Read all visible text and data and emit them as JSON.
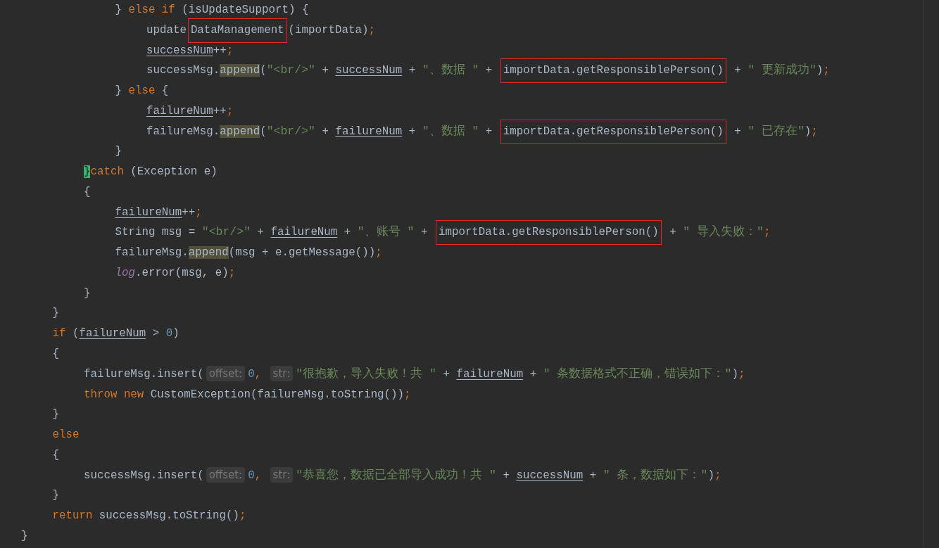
{
  "editor": {
    "lines": [
      {
        "children": [
          {
            "children": [
              {
                "children": [
                  {
                    "tokens": [
                      {
                        "kind": "plain",
                        "text": "} "
                      },
                      {
                        "kind": "keyword",
                        "text": "else if"
                      },
                      {
                        "kind": "plain",
                        "text": " (isUpdateSupport) {"
                      }
                    ]
                  },
                  {
                    "children": [
                      {
                        "tokens": [
                          {
                            "kind": "plain",
                            "text": "update"
                          },
                          {
                            "kind": "marked",
                            "text": "DataManagement"
                          },
                          {
                            "kind": "plain",
                            "text": "(importData)"
                          },
                          {
                            "kind": "keyword",
                            "text": ";"
                          }
                        ]
                      },
                      {
                        "tokens": [
                          {
                            "kind": "variable",
                            "text": "successNum"
                          },
                          {
                            "kind": "plain",
                            "text": "++"
                          },
                          {
                            "kind": "keyword",
                            "text": ";"
                          }
                        ]
                      },
                      {
                        "tokens": [
                          {
                            "kind": "plain",
                            "text": "successMsg."
                          },
                          {
                            "kind": "usage",
                            "text": "append"
                          },
                          {
                            "kind": "plain",
                            "text": "("
                          },
                          {
                            "kind": "string",
                            "text": "\"<br/>\""
                          },
                          {
                            "kind": "plain",
                            "text": " + "
                          },
                          {
                            "kind": "variable",
                            "text": "successNum"
                          },
                          {
                            "kind": "plain",
                            "text": " + "
                          },
                          {
                            "kind": "string",
                            "text": "\"、数据 \""
                          },
                          {
                            "kind": "plain",
                            "text": " + "
                          },
                          {
                            "kind": "marked",
                            "text": "importData.getResponsiblePerson()"
                          },
                          {
                            "kind": "plain",
                            "text": " + "
                          },
                          {
                            "kind": "string",
                            "text": "\" 更新成功\""
                          },
                          {
                            "kind": "plain",
                            "text": ")"
                          },
                          {
                            "kind": "keyword",
                            "text": ";"
                          }
                        ]
                      }
                    ]
                  },
                  {
                    "tokens": [
                      {
                        "kind": "plain",
                        "text": "} "
                      },
                      {
                        "kind": "keyword",
                        "text": "else"
                      },
                      {
                        "kind": "plain",
                        "text": " {"
                      }
                    ]
                  },
                  {
                    "children": [
                      {
                        "tokens": [
                          {
                            "kind": "variable",
                            "text": "failureNum"
                          },
                          {
                            "kind": "plain",
                            "text": "++"
                          },
                          {
                            "kind": "keyword",
                            "text": ";"
                          }
                        ]
                      },
                      {
                        "tokens": [
                          {
                            "kind": "plain",
                            "text": "failureMsg."
                          },
                          {
                            "kind": "usage",
                            "text": "append"
                          },
                          {
                            "kind": "plain",
                            "text": "("
                          },
                          {
                            "kind": "string",
                            "text": "\"<br/>\""
                          },
                          {
                            "kind": "plain",
                            "text": " + "
                          },
                          {
                            "kind": "variable",
                            "text": "failureNum"
                          },
                          {
                            "kind": "plain",
                            "text": " + "
                          },
                          {
                            "kind": "string",
                            "text": "\"、数据 \""
                          },
                          {
                            "kind": "plain",
                            "text": " + "
                          },
                          {
                            "kind": "marked",
                            "text": "importData.getResponsiblePerson()"
                          },
                          {
                            "kind": "plain",
                            "text": " + "
                          },
                          {
                            "kind": "string",
                            "text": "\" 已存在\""
                          },
                          {
                            "kind": "plain",
                            "text": ")"
                          },
                          {
                            "kind": "keyword",
                            "text": ";"
                          }
                        ]
                      }
                    ]
                  },
                  {
                    "tokens": [
                      {
                        "kind": "plain",
                        "text": "}"
                      }
                    ]
                  }
                ]
              },
              {
                "tokens": [
                  {
                    "kind": "brace",
                    "text": "}"
                  },
                  {
                    "kind": "keyword",
                    "text": "catch"
                  },
                  {
                    "kind": "plain",
                    "text": " (Exception e)"
                  }
                ]
              },
              {
                "tokens": [
                  {
                    "kind": "plain",
                    "text": "{"
                  }
                ]
              },
              {
                "children": [
                  {
                    "tokens": [
                      {
                        "kind": "variable",
                        "text": "failureNum"
                      },
                      {
                        "kind": "plain",
                        "text": "++"
                      },
                      {
                        "kind": "keyword",
                        "text": ";"
                      }
                    ]
                  },
                  {
                    "tokens": [
                      {
                        "kind": "plain",
                        "text": "String msg = "
                      },
                      {
                        "kind": "string",
                        "text": "\"<br/>\""
                      },
                      {
                        "kind": "plain",
                        "text": " + "
                      },
                      {
                        "kind": "variable",
                        "text": "failureNum"
                      },
                      {
                        "kind": "plain",
                        "text": " + "
                      },
                      {
                        "kind": "string",
                        "text": "\"、账号 \""
                      },
                      {
                        "kind": "plain",
                        "text": " + "
                      },
                      {
                        "kind": "marked",
                        "text": "importData.getResponsiblePerson()"
                      },
                      {
                        "kind": "plain",
                        "text": " + "
                      },
                      {
                        "kind": "string",
                        "text": "\" 导入失败：\""
                      },
                      {
                        "kind": "keyword",
                        "text": ";"
                      }
                    ]
                  },
                  {
                    "tokens": [
                      {
                        "kind": "plain",
                        "text": "failureMsg."
                      },
                      {
                        "kind": "usage",
                        "text": "append"
                      },
                      {
                        "kind": "plain",
                        "text": "(msg + e.getMessage())"
                      },
                      {
                        "kind": "keyword",
                        "text": ";"
                      }
                    ]
                  },
                  {
                    "tokens": [
                      {
                        "kind": "static",
                        "text": "log"
                      },
                      {
                        "kind": "plain",
                        "text": ".error(msg, e)"
                      },
                      {
                        "kind": "keyword",
                        "text": ";"
                      }
                    ]
                  }
                ]
              },
              {
                "tokens": [
                  {
                    "kind": "plain",
                    "text": "}"
                  }
                ]
              }
            ]
          },
          {
            "tokens": [
              {
                "kind": "plain",
                "text": "}"
              }
            ]
          },
          {
            "tokens": [
              {
                "kind": "keyword",
                "text": "if"
              },
              {
                "kind": "plain",
                "text": " ("
              },
              {
                "kind": "variable",
                "text": "failureNum"
              },
              {
                "kind": "plain",
                "text": " > "
              },
              {
                "kind": "number",
                "text": "0"
              },
              {
                "kind": "plain",
                "text": ")"
              }
            ]
          },
          {
            "tokens": [
              {
                "kind": "plain",
                "text": "{"
              }
            ]
          },
          {
            "children": [
              {
                "tokens": [
                  {
                    "kind": "plain",
                    "text": "failureMsg.insert("
                  },
                  {
                    "kind": "hint",
                    "text": "offset:"
                  },
                  {
                    "kind": "number",
                    "text": "0"
                  },
                  {
                    "kind": "keyword",
                    "text": ", "
                  },
                  {
                    "kind": "hint",
                    "text": "str:"
                  },
                  {
                    "kind": "string",
                    "text": "\"很抱歉，导入失败！共 \""
                  },
                  {
                    "kind": "plain",
                    "text": " + "
                  },
                  {
                    "kind": "variable",
                    "text": "failureNum"
                  },
                  {
                    "kind": "plain",
                    "text": " + "
                  },
                  {
                    "kind": "string",
                    "text": "\" 条数据格式不正确，错误如下：\""
                  },
                  {
                    "kind": "plain",
                    "text": ")"
                  },
                  {
                    "kind": "keyword",
                    "text": ";"
                  }
                ]
              },
              {
                "tokens": [
                  {
                    "kind": "keyword",
                    "text": "throw new"
                  },
                  {
                    "kind": "plain",
                    "text": " CustomException(failureMsg.toString())"
                  },
                  {
                    "kind": "keyword",
                    "text": ";"
                  }
                ]
              }
            ]
          },
          {
            "tokens": [
              {
                "kind": "plain",
                "text": "}"
              }
            ]
          },
          {
            "tokens": [
              {
                "kind": "keyword",
                "text": "else"
              }
            ]
          },
          {
            "tokens": [
              {
                "kind": "plain",
                "text": "{"
              }
            ]
          },
          {
            "children": [
              {
                "tokens": [
                  {
                    "kind": "plain",
                    "text": "successMsg.insert("
                  },
                  {
                    "kind": "hint",
                    "text": "offset:"
                  },
                  {
                    "kind": "number",
                    "text": "0"
                  },
                  {
                    "kind": "keyword",
                    "text": ", "
                  },
                  {
                    "kind": "hint",
                    "text": "str:"
                  },
                  {
                    "kind": "string",
                    "text": "\"恭喜您，数据已全部导入成功！共 \""
                  },
                  {
                    "kind": "plain",
                    "text": " + "
                  },
                  {
                    "kind": "variable",
                    "text": "successNum"
                  },
                  {
                    "kind": "plain",
                    "text": " + "
                  },
                  {
                    "kind": "string",
                    "text": "\" 条，数据如下：\""
                  },
                  {
                    "kind": "plain",
                    "text": ")"
                  },
                  {
                    "kind": "keyword",
                    "text": ";"
                  }
                ]
              }
            ]
          },
          {
            "tokens": [
              {
                "kind": "plain",
                "text": "}"
              }
            ]
          },
          {
            "tokens": [
              {
                "kind": "keyword",
                "text": "return"
              },
              {
                "kind": "plain",
                "text": " successMsg.toString()"
              },
              {
                "kind": "keyword",
                "text": ";"
              }
            ]
          }
        ]
      },
      {
        "tokens": [
          {
            "kind": "plain",
            "text": "}"
          }
        ]
      }
    ]
  }
}
